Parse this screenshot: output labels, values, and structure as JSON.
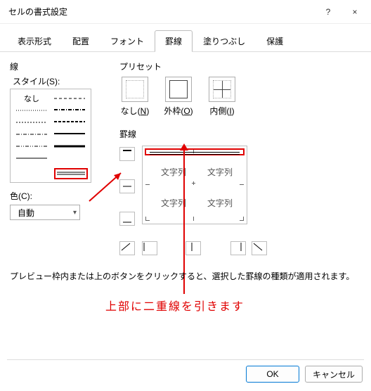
{
  "title": "セルの書式設定",
  "tabs": [
    "表示形式",
    "配置",
    "フォント",
    "罫線",
    "塗りつぶし",
    "保護"
  ],
  "active_tab": 3,
  "line_group": "線",
  "style_label": "スタイル(S):",
  "style_none": "なし",
  "color_label": "色(C):",
  "color_value": "自動",
  "preset_group": "プリセット",
  "presets": [
    {
      "label_pre": "なし(",
      "u": "N",
      "label_post": ")"
    },
    {
      "label_pre": "外枠(",
      "u": "O",
      "label_post": ")"
    },
    {
      "label_pre": "内側(",
      "u": "I",
      "label_post": ")"
    }
  ],
  "borders_group": "罫線",
  "cell_text": "文字列",
  "hint": "プレビュー枠内または上のボタンをクリックすると、選択した罫線の種類が適用されます。",
  "annotation": "上部に二重線を引きます",
  "ok": "OK",
  "cancel": "キャンセル",
  "help_tip": "?",
  "close_tip": "×"
}
